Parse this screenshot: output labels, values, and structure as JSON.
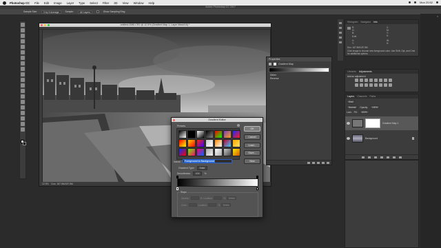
{
  "menubar": {
    "items": [
      "Photoshop CC",
      "File",
      "Edit",
      "Image",
      "Layer",
      "Type",
      "Select",
      "Filter",
      "3D",
      "View",
      "Window",
      "Help"
    ],
    "time": "Mon 20:52"
  },
  "app": {
    "title": "Adobe Photoshop CC 2017"
  },
  "options": {
    "sample_size_label": "Sample Size:",
    "sample_size_value": "3 by 3 Average",
    "sample_label": "Sample:",
    "sample_value": "All Layers",
    "show_ring": "Show Sampling Ring"
  },
  "document": {
    "title": "untitled-0080.CR2 @ 12.5% (Gradient Map 1, Layer Mask/16) *",
    "zoom": "12.5%",
    "status": "Doc: 187.5M/187.5M"
  },
  "properties": {
    "title": "Properties",
    "adjustment": "Gradient Map",
    "options": [
      "Dither",
      "Reverse"
    ]
  },
  "gradient_editor": {
    "title": "Gradient Editor",
    "presets_label": "Presets",
    "ok": "OK",
    "cancel": "Cancel",
    "load": "Load...",
    "save": "Save...",
    "name_label": "Name:",
    "name_value": "Foreground to Background",
    "new": "New",
    "type_label": "Gradient Type:",
    "type_value": "Solid",
    "smooth_label": "Smoothness:",
    "smooth_value": "100",
    "smooth_unit": "%",
    "stops_label": "Stops",
    "opacity_label": "Opacity:",
    "color_label": "Color:",
    "location_label": "Location:",
    "pct": "%",
    "delete": "Delete",
    "preset_colors": [
      [
        "#000000",
        "#ffffff"
      ],
      [
        "#000000",
        "#000000"
      ],
      [
        "#ffffff",
        "#000000"
      ],
      [
        "#000000",
        "#888888"
      ],
      [
        "#ff0000",
        "#00ff00"
      ],
      [
        "#7b3fbf",
        "#ff9f1a"
      ],
      [
        "#1a2bff",
        "#ff1a1a"
      ],
      [
        "#ff0000",
        "#ffff00"
      ],
      [
        "#ffd400",
        "#ff0000"
      ],
      [
        "#ff2a00",
        "#3a00ff"
      ],
      [
        "#c8c8c8",
        "#ffffff"
      ],
      [
        "#ff8800",
        "#ffffff"
      ],
      [
        "#cc0033",
        "#33ccff"
      ],
      [
        "#ffaa00",
        "#ffe066"
      ],
      [
        "#0033ff",
        "#ff0000"
      ],
      [
        "#66ff00",
        "#ff0066"
      ],
      [
        "#ff0066",
        "#0066ff"
      ],
      [
        "#aaaaaa",
        "#eeeeee"
      ],
      [
        "#ffffff",
        "#aaaaaa"
      ],
      [
        "#cccccc",
        "#444444"
      ],
      [
        "#ffee00",
        "#cc5500"
      ]
    ]
  },
  "histogram": {
    "tabs": [
      "Histogram",
      "Navigator",
      "Info"
    ],
    "r_label": "R:",
    "g_label": "G:",
    "b_label": "B:",
    "c_label": "C:",
    "m_label": "M:",
    "y_label": "Y:",
    "k_label": "K:",
    "bits": "8-bit",
    "x_label": "X:",
    "y2_label": "Y:",
    "w_label": "W:",
    "h_label": "H:",
    "doc": "Doc: 187.5M/187.5M",
    "hint": "Click image to choose new foreground color. Use Shift, Opt, and Cmd for additional options."
  },
  "adjustments": {
    "tabs": [
      "Libraries",
      "Adjustments"
    ],
    "add_label": "Add an adjustment"
  },
  "layers": {
    "tabs": [
      "Layers",
      "Channels",
      "Paths"
    ],
    "kind": "Kind",
    "blend": "Normal",
    "opacity_label": "Opacity:",
    "opacity_value": "100%",
    "lock_label": "Lock:",
    "fill_label": "Fill:",
    "fill_value": "100%",
    "items": [
      {
        "name": "Gradient Map 1",
        "selected": true
      },
      {
        "name": "Background",
        "selected": false
      }
    ]
  },
  "colors": {
    "accent": "#2d6fd6",
    "panel": "#3c3c3c",
    "dialog": "#535353"
  }
}
